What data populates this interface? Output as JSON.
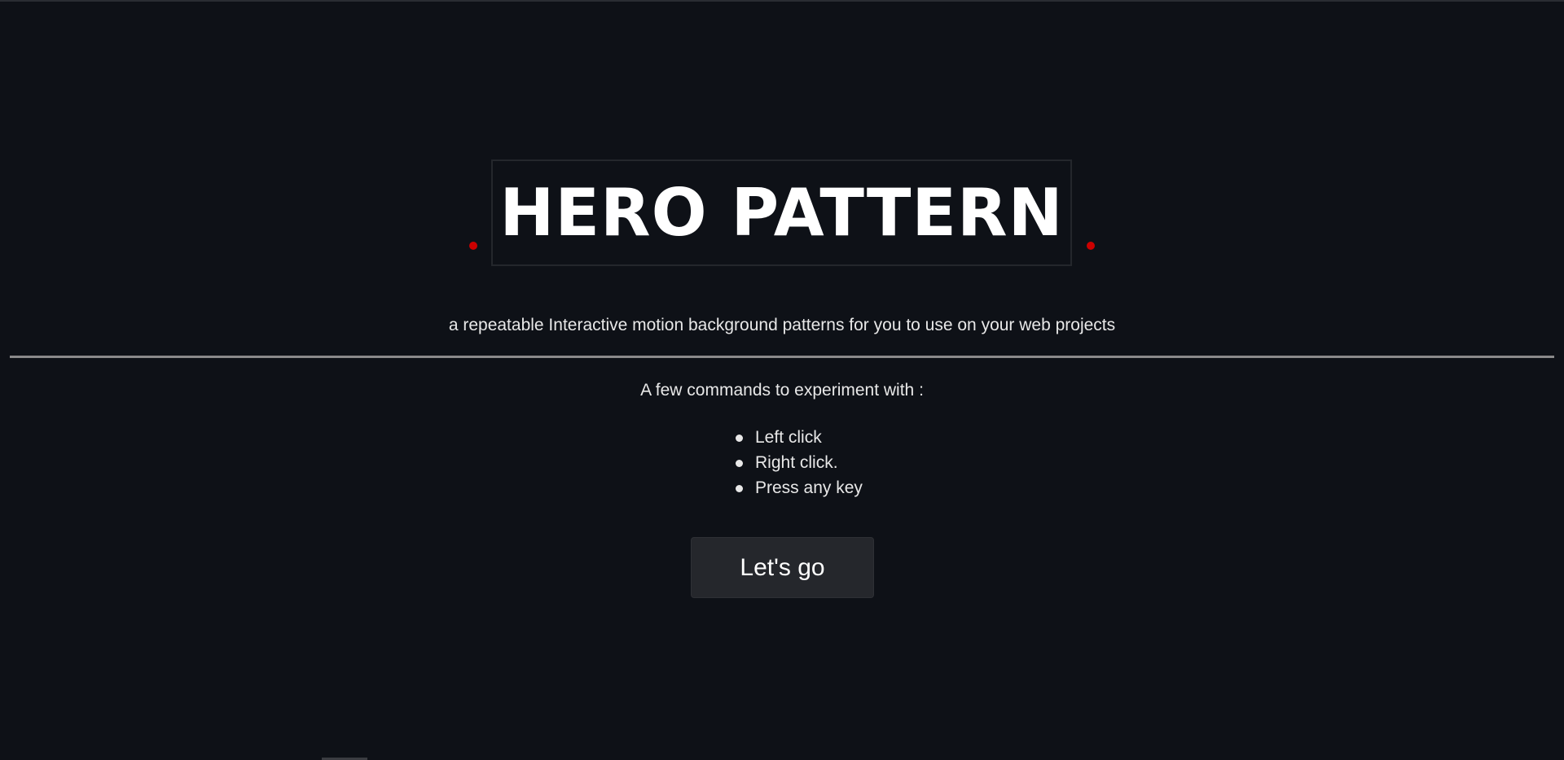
{
  "hero": {
    "title": "HERO PATTERN",
    "subtitle": "a repeatable Interactive motion background patterns for you to use on your web projects"
  },
  "commands": {
    "heading": "A few commands to experiment with :",
    "items": [
      {
        "label": "Left click"
      },
      {
        "label": "Right click."
      },
      {
        "label": "Press any key"
      }
    ]
  },
  "cta": {
    "label": "Let's go"
  },
  "colors": {
    "background": "#0e1117",
    "accent_dot": "#cc0000",
    "button_bg": "#25272c"
  }
}
